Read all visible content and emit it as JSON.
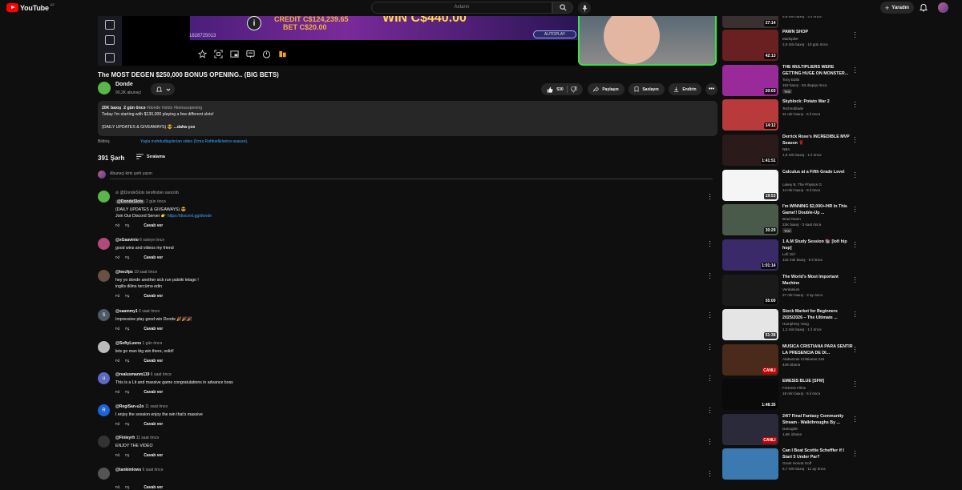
{
  "topbar": {
    "logo_text": "YouTube",
    "country": "AZ",
    "search_placeholder": "Axtarın",
    "create_label": "Yaradın"
  },
  "player": {
    "credit_label": "CREDIT",
    "credit_value": "C$124,239.65",
    "bet_label": "BET",
    "bet_value": "C$20.00",
    "win_value": "WIN C$440.00",
    "stream_id": "1828725013",
    "autoplay_label": "AUTOPLAY"
  },
  "video": {
    "title": "The MOST DEGEN $250,000 BONUS OPENING.. (BIG BETS)",
    "channel": "Donde",
    "subscribers": "90,2K abunəçi",
    "likes": "530",
    "share_label": "Paylaşın",
    "save_label": "Saxlayın",
    "download_label": "Endirin"
  },
  "description": {
    "views": "20K baxış",
    "age": "2 gün öncə",
    "tags": "#donde #slots #bonusopening",
    "line1": "Today I'm starting with $130,000 playing a few different slots!",
    "line2": "(DAILY UPDATES & GIVEAWAYS)",
    "more": "...daha çox"
  },
  "notice": {
    "label": "Bildiriş",
    "text": "Yaşla məhdudlaşdırılan video (İcma Rəhbərliklərinə əsasən)."
  },
  "comments_section": {
    "count": "391 Şərh",
    "sort_label": "Sıralama",
    "add_placeholder": "Abunəçi kimi şərh yazın"
  },
  "comments": [
    {
      "pinned_by": "@DondeSlots tərəfindən sancılıb",
      "author": "@DondeSlots",
      "time": "2 gün öncə",
      "lines": [
        "(DAILY UPDATES & GIVEAWAYS) 😎",
        "Join Our Discord Server 👉"
      ],
      "link": "https://discord.gg/donde",
      "reply": "Cavab ver",
      "avatar_color": "#5ab54a",
      "initial": ""
    },
    {
      "author": "@xGaavinio",
      "time": "6 saniyə öncə",
      "lines": [
        "good wins and videos my friend"
      ],
      "reply": "Cavab ver",
      "avatar_color": "#b04a7a",
      "initial": ""
    },
    {
      "author": "@leezfps",
      "time": "19 saat öncə",
      "lines": [
        "hey yo donde another sick run palsiki letago !",
        "ingilis dilinə tərcümə edin"
      ],
      "reply": "Cavab ver",
      "avatar_color": "#6a5040",
      "initial": ""
    },
    {
      "author": "@saammy1",
      "time": "6 saat öncə",
      "lines": [
        "Impressive play good win Donde 🎉🎉🎉"
      ],
      "reply": "Cavab ver",
      "avatar_color": "#4d5a66",
      "initial": "S"
    },
    {
      "author": "@SoftyLuens",
      "time": "1 gün öncə",
      "lines": [
        "lets go man big win there, solid!"
      ],
      "reply": "Cavab ver",
      "avatar_color": "#bbbbbb",
      "initial": ""
    },
    {
      "author": "@realusmanm119",
      "time": "6 saat öncə",
      "lines": [
        "This is a Lit and massive game congratulations in  advance boss"
      ],
      "reply": "Cavab ver",
      "avatar_color": "#5c6bc0",
      "initial": "u"
    },
    {
      "author": "@RegiSan-u2o",
      "time": "11 saat öncə",
      "lines": [
        "I enjoy the session enjoy the win that's massive"
      ],
      "reply": "Cavab ver",
      "avatar_color": "#1e63d6",
      "initial": "R"
    },
    {
      "author": "@Finleyrh",
      "time": "11 saat öncə",
      "lines": [
        "ENJOY THE VIDEO"
      ],
      "reply": "Cavab ver",
      "avatar_color": "#333333",
      "initial": ""
    },
    {
      "author": "@tankimlows",
      "time": "6 saat öncə",
      "lines": [
        ""
      ],
      "reply": "Cavab ver",
      "avatar_color": "#555555",
      "initial": ""
    }
  ],
  "related": [
    {
      "title": "",
      "channel": "",
      "meta": "5,9 mln baxış · 2 il öncə",
      "duration": "27:14",
      "thumb": "#3a3030",
      "new": ""
    },
    {
      "title": "PAWN SHOP",
      "channel": "Markiplier",
      "meta": "2,5 mln baxış · 10 gün öncə",
      "duration": "42:13",
      "thumb": "#6a2020",
      "new": ""
    },
    {
      "title": "THE MULTIPLIERS WERE GETTING HUGE ON MONSTER...",
      "channel": "Tony Edits",
      "meta": "152 baxış · 53 dəqiqə öncə",
      "duration": "20:03",
      "thumb": "#9a2a9a",
      "new": "Yeni"
    },
    {
      "title": "Skyblock: Potato War 2",
      "channel": "Technoblade",
      "meta": "31 mln baxış · 6 il öncə",
      "duration": "14:12",
      "thumb": "#b83a3a",
      "new": ""
    },
    {
      "title": "Derrick Rose's INCREDIBLE MVP Season 🌹",
      "channel": "NBA",
      "meta": "1,9 mln baxış · 1 il öncə",
      "duration": "1:41:51",
      "thumb": "#2a1a1a",
      "new": ""
    },
    {
      "title": "Calculus at a Fifth Grade Level",
      "channel": "Lukey B. The Physics G",
      "meta": "14 mln baxış · 8 il öncə",
      "duration": "19:53",
      "thumb": "#f5f5f5",
      "new": ""
    },
    {
      "title": "I'm WINNING $2,000+/HR In This Game!! Double-Up ...",
      "channel": "Brad Owen",
      "meta": "22K baxış · 3 saat öncə",
      "duration": "30:29",
      "thumb": "#4a5a4a",
      "new": "Yeni"
    },
    {
      "title": "1 A.M Study Session 📚 [lofi hip hop]",
      "channel": "Lofi Girl",
      "meta": "132 mln baxış · 6 il öncə",
      "duration": "1:01:14",
      "thumb": "#3a2a6a",
      "new": ""
    },
    {
      "title": "The World's Most Important Machine",
      "channel": "Veritasium",
      "meta": "27 mln baxış · 3 ay öncə",
      "duration": "55:00",
      "thumb": "#1a1a1a",
      "new": ""
    },
    {
      "title": "Stock Market for Beginners 2025/2026 – The Ultimate ...",
      "channel": "Humphrey Yang",
      "meta": "1,2 mln baxış · 1 il öncə",
      "duration": "51:38",
      "thumb": "#e5e5e5",
      "new": ""
    },
    {
      "title": "MUSICA CRISTIANA PARA SENTIR LA PRESENCIA DE DI...",
      "channel": "Alabanzas Cristianas 318",
      "meta": "449 izləmə",
      "duration": "CANLI",
      "thumb": "#4a2a1a",
      "new": ""
    },
    {
      "title": "EMESIS BLUE [SFM]",
      "channel": "Fortress Films",
      "meta": "19 mln baxış · 5 il öncə",
      "duration": "1:48:35",
      "thumb": "#0a0a0a",
      "new": ""
    },
    {
      "title": "24/7 Final Fantasy Community Stream - Walkthroughs By ...",
      "channel": "Danog08",
      "meta": "1,6K izləmə",
      "duration": "CANLI",
      "thumb": "#2a2a3a",
      "new": ""
    },
    {
      "title": "Can I Beat Scottie Scheffler if I Start 5 Under Par?",
      "channel": "Grant Horvat Golf",
      "meta": "6,7 mln baxış · 11 ay öncə",
      "duration": "",
      "thumb": "#3a7ab0",
      "new": ""
    }
  ],
  "colors": {
    "background": "#0f0f0f",
    "surface": "#272727",
    "link": "#3ea6ff",
    "brand": "#ff0000"
  }
}
